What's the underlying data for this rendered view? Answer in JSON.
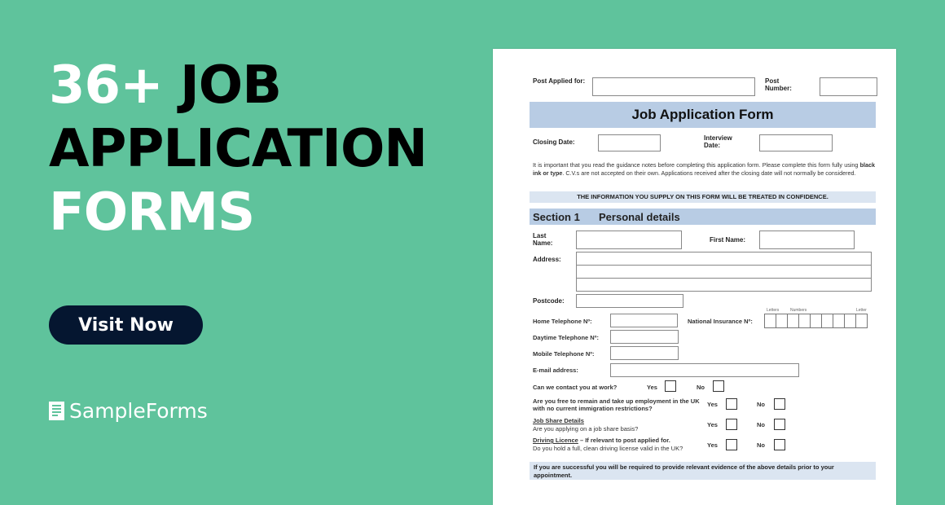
{
  "banner": {
    "headline_line1_white": "36+",
    "headline_line1_black": "JOB",
    "headline_line2": "APPLICATION",
    "headline_line3": "FORMS",
    "cta_label": "Visit Now",
    "brand_name": "SampleForms",
    "brand_icon": "document-icon",
    "colors": {
      "background": "#5fc39c",
      "cta": "#051630"
    }
  },
  "form": {
    "post_applied_label": "Post Applied for:",
    "post_number_label": "Post Number:",
    "title": "Job Application Form",
    "closing_date_label": "Closing Date:",
    "interview_date_label": "Interview Date:",
    "guidance_pre": "It is important that you read the guidance notes before completing this application form. Please complete this form fully using ",
    "guidance_bold": "black ink or type",
    "guidance_post": ". C.V.s are not accepted on their own. Applications received after the closing date will not normally be considered.",
    "confidence_notice": "THE INFORMATION YOU SUPPLY ON THIS FORM WILL BE TREATED IN CONFIDENCE.",
    "section_number": "Section 1",
    "section_title": "Personal details",
    "last_name_label": "Last Name:",
    "first_name_label": "First Name:",
    "address_label": "Address:",
    "postcode_label": "Postcode:",
    "home_tel_label": "Home Telephone Nº:",
    "ni_label": "National Insurance Nº:",
    "ni_letters": "Letters",
    "ni_numbers": "Numbers",
    "ni_letter": "Letter",
    "daytime_tel_label": "Daytime Telephone Nº:",
    "mobile_tel_label": "Mobile Telephone Nº:",
    "email_label": "E-mail address:",
    "contact_work_q": "Can we contact you at work?",
    "immigration_q": "Are you free to remain and take up employment in the UK with no current immigration restrictions?",
    "job_share_heading": "Job Share Details",
    "job_share_q": "Are you applying on a job share basis?",
    "driving_heading": "Driving Licence",
    "driving_heading_suffix": " – If relevant to post applied for.",
    "driving_q": "Do you hold a full, clean driving license valid in the UK?",
    "yes": "Yes",
    "no": "No",
    "evidence_notice": "If you are successful you will be required to provide relevant evidence of the above details prior to your appointment."
  }
}
